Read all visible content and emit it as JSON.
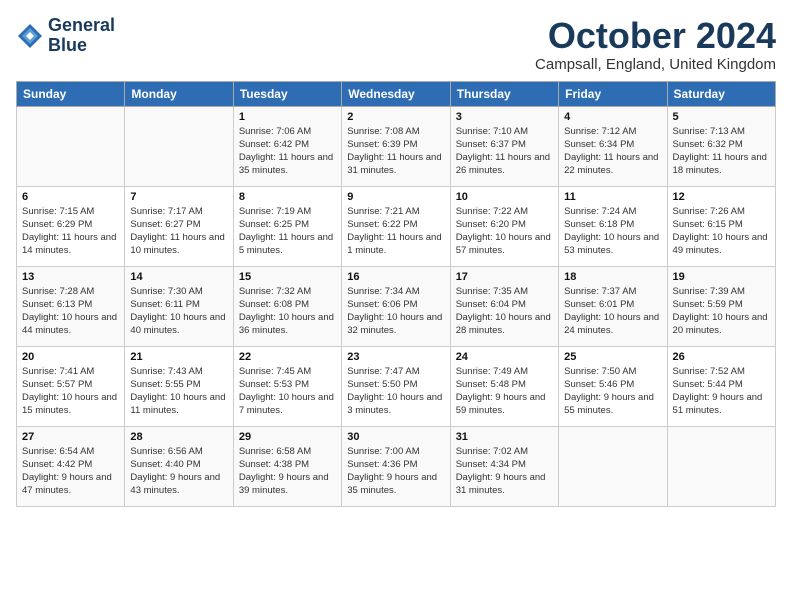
{
  "header": {
    "logo_line1": "General",
    "logo_line2": "Blue",
    "month": "October 2024",
    "location": "Campsall, England, United Kingdom"
  },
  "days_of_week": [
    "Sunday",
    "Monday",
    "Tuesday",
    "Wednesday",
    "Thursday",
    "Friday",
    "Saturday"
  ],
  "weeks": [
    [
      {
        "day": "",
        "content": ""
      },
      {
        "day": "",
        "content": ""
      },
      {
        "day": "1",
        "content": "Sunrise: 7:06 AM\nSunset: 6:42 PM\nDaylight: 11 hours and 35 minutes."
      },
      {
        "day": "2",
        "content": "Sunrise: 7:08 AM\nSunset: 6:39 PM\nDaylight: 11 hours and 31 minutes."
      },
      {
        "day": "3",
        "content": "Sunrise: 7:10 AM\nSunset: 6:37 PM\nDaylight: 11 hours and 26 minutes."
      },
      {
        "day": "4",
        "content": "Sunrise: 7:12 AM\nSunset: 6:34 PM\nDaylight: 11 hours and 22 minutes."
      },
      {
        "day": "5",
        "content": "Sunrise: 7:13 AM\nSunset: 6:32 PM\nDaylight: 11 hours and 18 minutes."
      }
    ],
    [
      {
        "day": "6",
        "content": "Sunrise: 7:15 AM\nSunset: 6:29 PM\nDaylight: 11 hours and 14 minutes."
      },
      {
        "day": "7",
        "content": "Sunrise: 7:17 AM\nSunset: 6:27 PM\nDaylight: 11 hours and 10 minutes."
      },
      {
        "day": "8",
        "content": "Sunrise: 7:19 AM\nSunset: 6:25 PM\nDaylight: 11 hours and 5 minutes."
      },
      {
        "day": "9",
        "content": "Sunrise: 7:21 AM\nSunset: 6:22 PM\nDaylight: 11 hours and 1 minute."
      },
      {
        "day": "10",
        "content": "Sunrise: 7:22 AM\nSunset: 6:20 PM\nDaylight: 10 hours and 57 minutes."
      },
      {
        "day": "11",
        "content": "Sunrise: 7:24 AM\nSunset: 6:18 PM\nDaylight: 10 hours and 53 minutes."
      },
      {
        "day": "12",
        "content": "Sunrise: 7:26 AM\nSunset: 6:15 PM\nDaylight: 10 hours and 49 minutes."
      }
    ],
    [
      {
        "day": "13",
        "content": "Sunrise: 7:28 AM\nSunset: 6:13 PM\nDaylight: 10 hours and 44 minutes."
      },
      {
        "day": "14",
        "content": "Sunrise: 7:30 AM\nSunset: 6:11 PM\nDaylight: 10 hours and 40 minutes."
      },
      {
        "day": "15",
        "content": "Sunrise: 7:32 AM\nSunset: 6:08 PM\nDaylight: 10 hours and 36 minutes."
      },
      {
        "day": "16",
        "content": "Sunrise: 7:34 AM\nSunset: 6:06 PM\nDaylight: 10 hours and 32 minutes."
      },
      {
        "day": "17",
        "content": "Sunrise: 7:35 AM\nSunset: 6:04 PM\nDaylight: 10 hours and 28 minutes."
      },
      {
        "day": "18",
        "content": "Sunrise: 7:37 AM\nSunset: 6:01 PM\nDaylight: 10 hours and 24 minutes."
      },
      {
        "day": "19",
        "content": "Sunrise: 7:39 AM\nSunset: 5:59 PM\nDaylight: 10 hours and 20 minutes."
      }
    ],
    [
      {
        "day": "20",
        "content": "Sunrise: 7:41 AM\nSunset: 5:57 PM\nDaylight: 10 hours and 15 minutes."
      },
      {
        "day": "21",
        "content": "Sunrise: 7:43 AM\nSunset: 5:55 PM\nDaylight: 10 hours and 11 minutes."
      },
      {
        "day": "22",
        "content": "Sunrise: 7:45 AM\nSunset: 5:53 PM\nDaylight: 10 hours and 7 minutes."
      },
      {
        "day": "23",
        "content": "Sunrise: 7:47 AM\nSunset: 5:50 PM\nDaylight: 10 hours and 3 minutes."
      },
      {
        "day": "24",
        "content": "Sunrise: 7:49 AM\nSunset: 5:48 PM\nDaylight: 9 hours and 59 minutes."
      },
      {
        "day": "25",
        "content": "Sunrise: 7:50 AM\nSunset: 5:46 PM\nDaylight: 9 hours and 55 minutes."
      },
      {
        "day": "26",
        "content": "Sunrise: 7:52 AM\nSunset: 5:44 PM\nDaylight: 9 hours and 51 minutes."
      }
    ],
    [
      {
        "day": "27",
        "content": "Sunrise: 6:54 AM\nSunset: 4:42 PM\nDaylight: 9 hours and 47 minutes."
      },
      {
        "day": "28",
        "content": "Sunrise: 6:56 AM\nSunset: 4:40 PM\nDaylight: 9 hours and 43 minutes."
      },
      {
        "day": "29",
        "content": "Sunrise: 6:58 AM\nSunset: 4:38 PM\nDaylight: 9 hours and 39 minutes."
      },
      {
        "day": "30",
        "content": "Sunrise: 7:00 AM\nSunset: 4:36 PM\nDaylight: 9 hours and 35 minutes."
      },
      {
        "day": "31",
        "content": "Sunrise: 7:02 AM\nSunset: 4:34 PM\nDaylight: 9 hours and 31 minutes."
      },
      {
        "day": "",
        "content": ""
      },
      {
        "day": "",
        "content": ""
      }
    ]
  ]
}
